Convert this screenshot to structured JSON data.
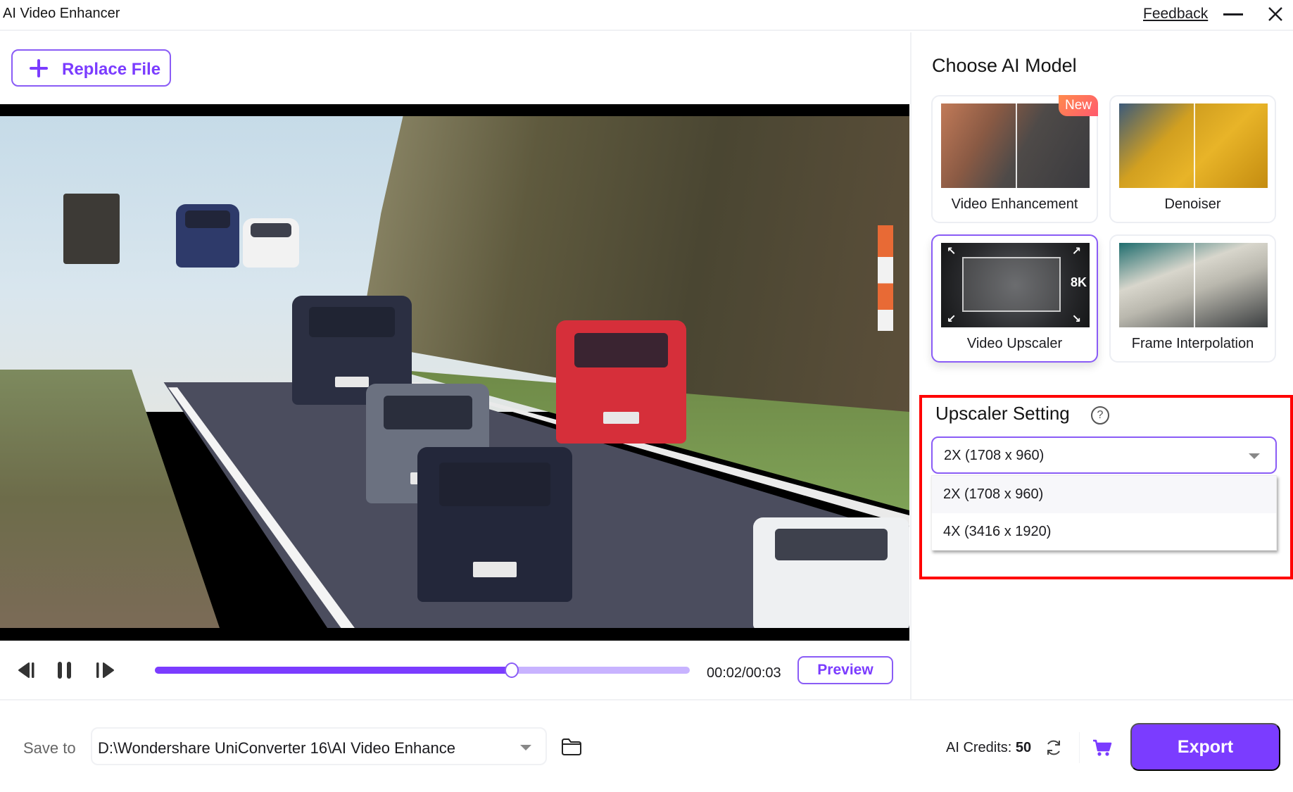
{
  "window": {
    "title": "AI Video Enhancer",
    "feedback_label": "Feedback",
    "minimize_icon": "minimize-icon",
    "close_icon": "close-icon"
  },
  "toolbar": {
    "replace_file_label": "Replace File",
    "replace_file_icon": "plus-icon"
  },
  "player": {
    "prev_frame_icon": "previous-frame-icon",
    "pause_icon": "pause-icon",
    "next_frame_icon": "next-frame-icon",
    "current_time": "00:02",
    "total_time": "00:03",
    "time_readout": "00:02/00:03",
    "progress_fraction": 0.667,
    "preview_label": "Preview"
  },
  "models": {
    "title": "Choose AI Model",
    "items": [
      {
        "name": "Video Enhancement",
        "badge": "New",
        "selected": false
      },
      {
        "name": "Denoiser",
        "badge": null,
        "selected": false
      },
      {
        "name": "Video Upscaler",
        "badge": null,
        "selected": true,
        "thumb_label": "8K"
      },
      {
        "name": "Frame Interpolation",
        "badge": null,
        "selected": false
      }
    ]
  },
  "upscaler": {
    "title": "Upscaler Setting",
    "help_icon": "help-icon",
    "selected": "2X (1708 x 960)",
    "options": [
      "2X (1708 x 960)",
      "4X (3416 x 1920)"
    ]
  },
  "footer": {
    "save_to_label": "Save to",
    "save_path": "D:\\Wondershare UniConverter 16\\AI Video Enhance",
    "folder_icon": "folder-icon",
    "credits_label": "AI Credits:",
    "credits_value": "50",
    "refresh_icon": "refresh-icon",
    "cart_icon": "cart-icon",
    "export_label": "Export"
  },
  "colors": {
    "accent": "#7b3cff",
    "accent_border": "#8a5cf6",
    "progress_track": "#c8b3ff",
    "highlight": "#ff0000",
    "badge_new": "#ff6a5c"
  }
}
